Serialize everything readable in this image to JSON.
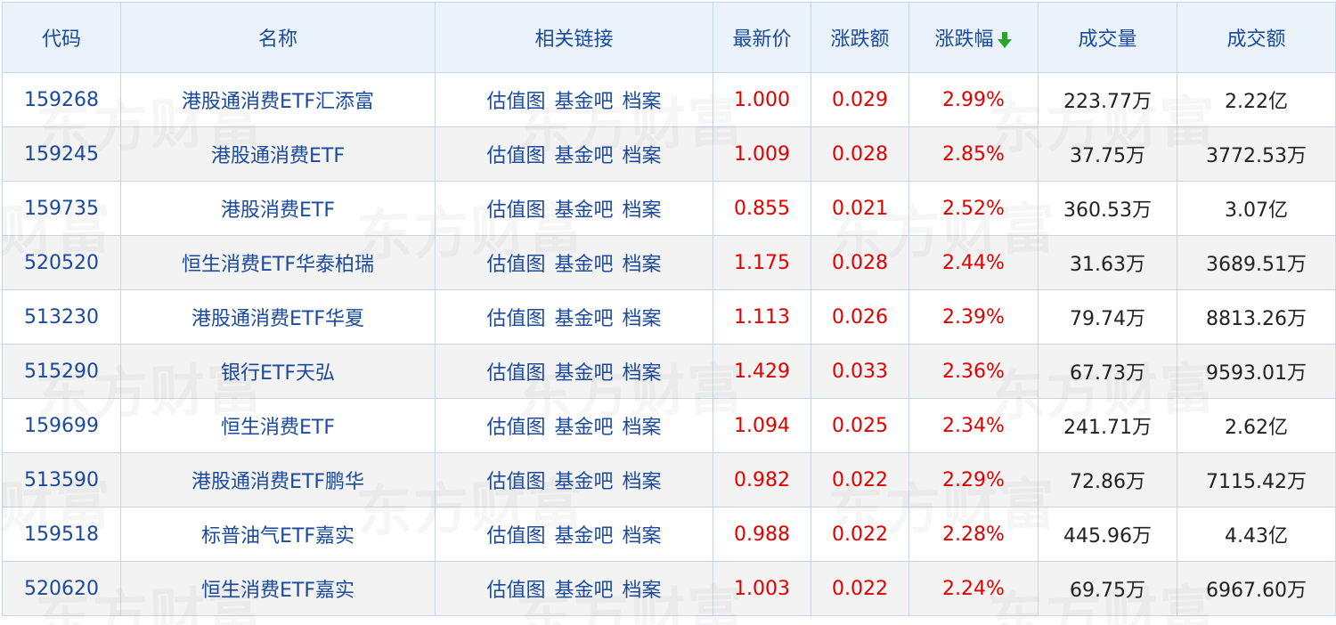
{
  "table": {
    "headers": {
      "code": "代码",
      "name": "名称",
      "links": "相关链接",
      "price": "最新价",
      "change": "涨跌额",
      "change_pct": "涨跌幅",
      "volume": "成交量",
      "amount": "成交额"
    },
    "sorted_column": "change_pct",
    "sort_direction": "desc",
    "sort_icon": "arrow-down-icon",
    "link_labels": [
      "估值图",
      "基金吧",
      "档案"
    ],
    "rows": [
      {
        "code": "159268",
        "name": "港股通消费ETF汇添富",
        "price": "1.000",
        "change": "0.029",
        "change_pct": "2.99%",
        "volume": "223.77万",
        "amount": "2.22亿"
      },
      {
        "code": "159245",
        "name": "港股通消费ETF",
        "price": "1.009",
        "change": "0.028",
        "change_pct": "2.85%",
        "volume": "37.75万",
        "amount": "3772.53万"
      },
      {
        "code": "159735",
        "name": "港股消费ETF",
        "price": "0.855",
        "change": "0.021",
        "change_pct": "2.52%",
        "volume": "360.53万",
        "amount": "3.07亿"
      },
      {
        "code": "520520",
        "name": "恒生消费ETF华泰柏瑞",
        "price": "1.175",
        "change": "0.028",
        "change_pct": "2.44%",
        "volume": "31.63万",
        "amount": "3689.51万"
      },
      {
        "code": "513230",
        "name": "港股通消费ETF华夏",
        "price": "1.113",
        "change": "0.026",
        "change_pct": "2.39%",
        "volume": "79.74万",
        "amount": "8813.26万"
      },
      {
        "code": "515290",
        "name": "银行ETF天弘",
        "price": "1.429",
        "change": "0.033",
        "change_pct": "2.36%",
        "volume": "67.73万",
        "amount": "9593.01万"
      },
      {
        "code": "159699",
        "name": "恒生消费ETF",
        "price": "1.094",
        "change": "0.025",
        "change_pct": "2.34%",
        "volume": "241.71万",
        "amount": "2.62亿"
      },
      {
        "code": "513590",
        "name": "港股通消费ETF鹏华",
        "price": "0.982",
        "change": "0.022",
        "change_pct": "2.29%",
        "volume": "72.86万",
        "amount": "7115.42万"
      },
      {
        "code": "159518",
        "name": "标普油气ETF嘉实",
        "price": "0.988",
        "change": "0.022",
        "change_pct": "2.28%",
        "volume": "445.96万",
        "amount": "4.43亿"
      },
      {
        "code": "520620",
        "name": "恒生消费ETF嘉实",
        "price": "1.003",
        "change": "0.022",
        "change_pct": "2.24%",
        "volume": "69.75万",
        "amount": "6967.60万"
      }
    ]
  },
  "watermark": {
    "text": "东方财富"
  },
  "colors": {
    "header_bg": "#eaf2fb",
    "header_text": "#1b4a9c",
    "link_text": "#1b4a9c",
    "up_red": "#e10000",
    "border": "#c5d6ea",
    "stripe": "#f3f3f3",
    "sort_arrow": "#2aa52a"
  }
}
